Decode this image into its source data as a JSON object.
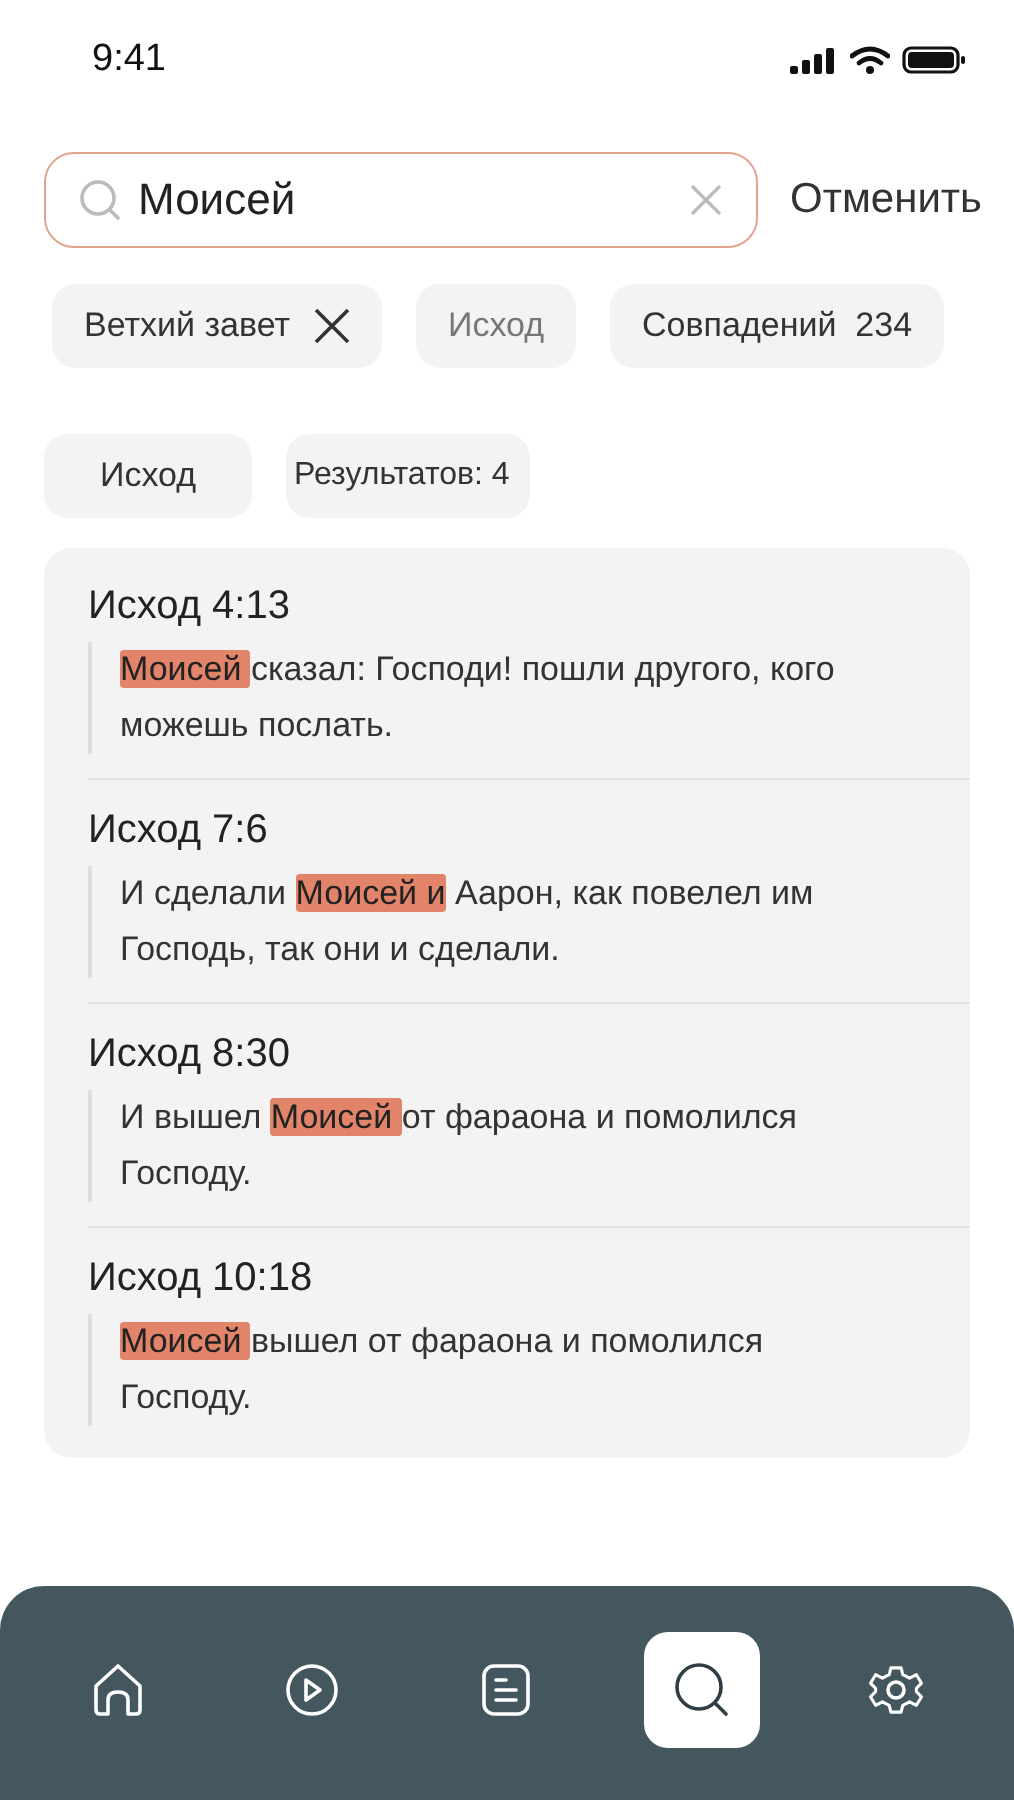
{
  "status_bar": {
    "time": "9:41"
  },
  "search": {
    "value": "Моисей",
    "cancel": "Отменить"
  },
  "filters": [
    {
      "label": "Ветхий завет",
      "kind": "removable"
    },
    {
      "label": "Исход",
      "kind": "faded"
    },
    {
      "label": "Совпадений",
      "count": "234",
      "kind": "count"
    }
  ],
  "summary": [
    {
      "label": "Исход",
      "kind": "book"
    },
    {
      "label": "Результатов:",
      "count": "4",
      "kind": "count"
    }
  ],
  "results": [
    {
      "ref": "Исход 4:13",
      "match": "Моисей ",
      "after": "сказал: Господи! пошли другого, кого можешь послать."
    },
    {
      "ref": "Исход 7:6",
      "before": "И сделали ",
      "match": "Моисей и",
      "after": " Аарон, как повелел им Господь, так они и сделали."
    },
    {
      "ref": "Исход 8:30",
      "before": "И вышел ",
      "match": "Моисей ",
      "after": "от фараона и помолился Господу."
    },
    {
      "ref": "Исход 10:18",
      "match": "Моисей ",
      "after": "вышел от фараона и помолился Господу."
    }
  ],
  "tab_bar": [
    {
      "kind": "home",
      "selected": false
    },
    {
      "kind": "play",
      "selected": false
    },
    {
      "kind": "notes",
      "selected": false
    },
    {
      "kind": "search",
      "selected": true
    },
    {
      "kind": "settings",
      "selected": false
    }
  ]
}
